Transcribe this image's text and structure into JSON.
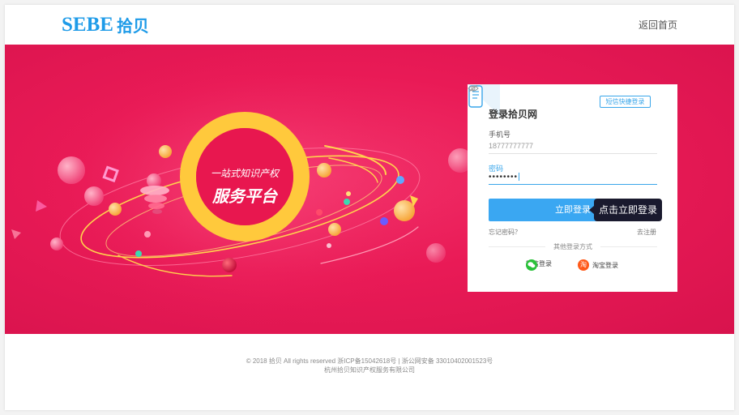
{
  "header": {
    "logo_en": "SEBE",
    "logo_cn": "拾贝",
    "home_link": "返回首页"
  },
  "banner": {
    "line1": "一站式知识产权",
    "line2": "服务平台"
  },
  "login": {
    "sms_tag": "短信快捷登录",
    "title": "登录拾贝网",
    "phone_label": "手机号",
    "phone_value": "18777777777",
    "password_label": "密码",
    "password_value": "••••••••",
    "submit_label": "立即登录",
    "tooltip": "点击立即登录",
    "forgot_label": "忘记密码？",
    "register_label": "去注册",
    "other_title": "其他登录方式",
    "wechat_label": "微信登录",
    "taobao_label": "淘宝登录",
    "taobao_glyph": "淘"
  },
  "footer": {
    "line1": "© 2018 拾贝 All rights reserved 浙ICP备15042618号 | 浙公网安备 33010402001523号",
    "line2": "杭州拾贝知识产权服务有限公司"
  },
  "colors": {
    "brand": "#1e9be8",
    "banner": "#e91a56",
    "button": "#3aa7f2",
    "ring": "#ffc93c"
  }
}
